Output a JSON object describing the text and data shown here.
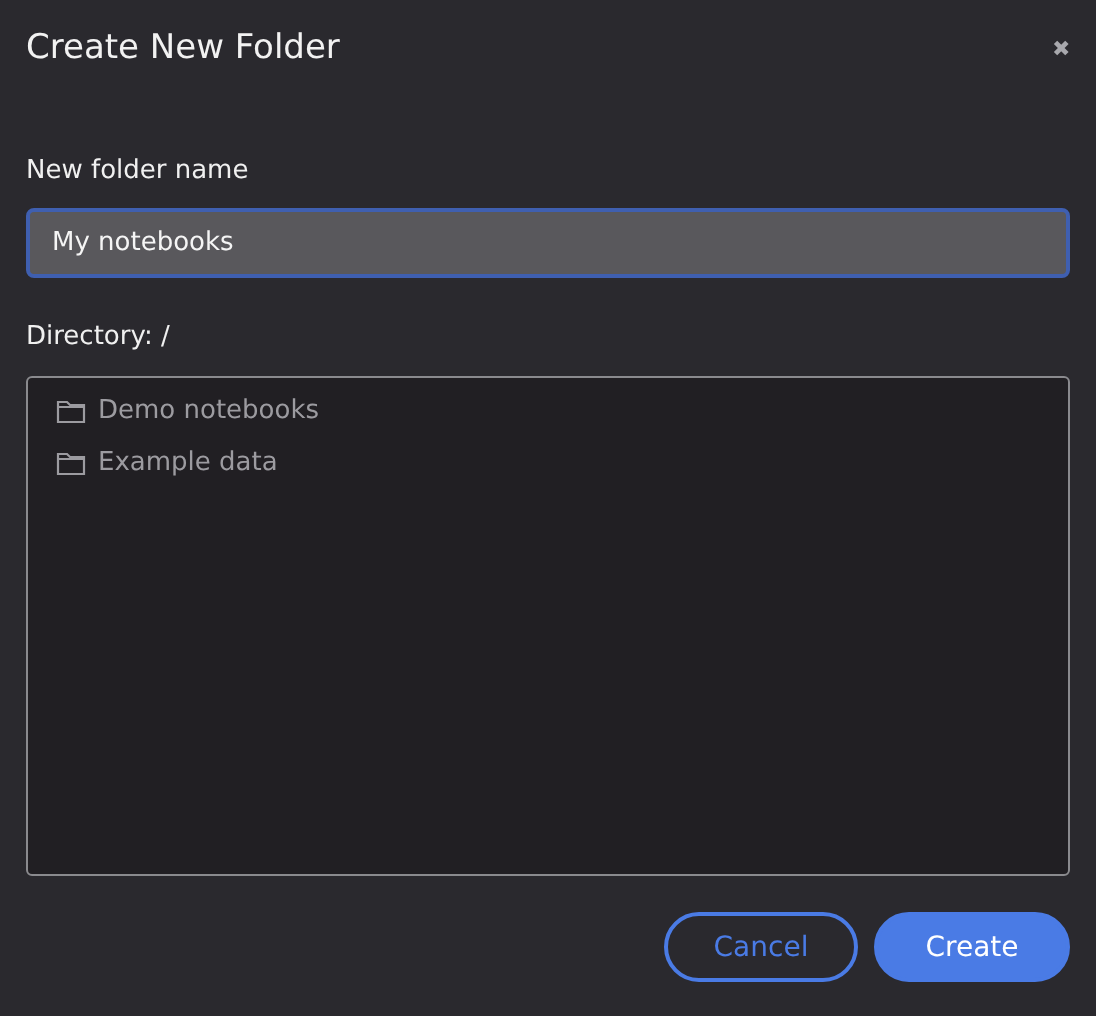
{
  "dialog": {
    "title": "Create New Folder",
    "close": "✖"
  },
  "name_field": {
    "label": "New folder name",
    "value": "My notebooks",
    "focused": true
  },
  "directory": {
    "label": "Directory: /",
    "items": [
      {
        "name": "Demo notebooks"
      },
      {
        "name": "Example data"
      }
    ]
  },
  "buttons": [
    {
      "label": "Cancel",
      "kind": "secondary"
    },
    {
      "label": "Create",
      "kind": "primary"
    }
  ]
}
